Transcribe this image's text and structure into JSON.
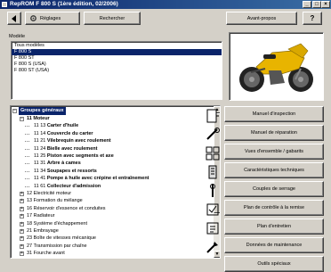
{
  "window": {
    "title": "RepROM F 800 S (1ère édition, 02/2006)"
  },
  "toolbar": {
    "settings_label": "Réglages",
    "search_label": "Rechercher",
    "about_label": "Avant-propos",
    "help_label": "?"
  },
  "model": {
    "label": "Modèle",
    "items": [
      "Tous modèles",
      "F 800 S",
      "F 800 ST",
      "F 800 S (USA)",
      "F 800 ST (USA)"
    ],
    "selected": "F 800 S"
  },
  "tree": {
    "root": "Groupes généraux",
    "rows": [
      {
        "num": "11",
        "text": "Moteur",
        "level": 1,
        "bold": true
      },
      {
        "num": "11 13",
        "text": "Carter d'huile",
        "level": 2
      },
      {
        "num": "11 14",
        "text": "Couvercle du carter",
        "level": 2
      },
      {
        "num": "11 21",
        "text": "Vilebrequin avec roulement",
        "level": 2
      },
      {
        "num": "11 24",
        "text": "Bielle avec roulement",
        "level": 2
      },
      {
        "num": "11 25",
        "text": "Piston avec segments et axe",
        "level": 2
      },
      {
        "num": "11 31",
        "text": "Arbre à cames",
        "level": 2
      },
      {
        "num": "11 34",
        "text": "Soupapes et ressorts",
        "level": 2
      },
      {
        "num": "11 41",
        "text": "Pompe à huile avec crépine et entraînement",
        "level": 2
      },
      {
        "num": "11 61",
        "text": "Collecteur d'admission",
        "level": 2
      },
      {
        "num": "12",
        "text": "Electricité moteur",
        "level": 1
      },
      {
        "num": "13",
        "text": "Formation du mélange",
        "level": 1
      },
      {
        "num": "16",
        "text": "Réservoir d'essence et conduites",
        "level": 1
      },
      {
        "num": "17",
        "text": "Radiateur",
        "level": 1
      },
      {
        "num": "18",
        "text": "Système d'échappement",
        "level": 1
      },
      {
        "num": "21",
        "text": "Embrayage",
        "level": 1
      },
      {
        "num": "23",
        "text": "Boîte de vitesses mécanique",
        "level": 1
      },
      {
        "num": "27",
        "text": "Transmission par chaîne",
        "level": 1
      },
      {
        "num": "31",
        "text": "Fourche avant",
        "level": 1
      }
    ]
  },
  "actions": [
    "Manuel d'inspection",
    "Manuel de réparation",
    "Vues d'ensemble / gabarits",
    "Caractéristiques techniques",
    "Couples de serrage",
    "Plan de contrôle à la remise",
    "Plan d'entretien",
    "Données de maintenance",
    "Outils spéciaux"
  ],
  "colors": {
    "titlebar": "#0a246a",
    "selection": "#0a246a",
    "bike_yellow": "#e8b400"
  }
}
